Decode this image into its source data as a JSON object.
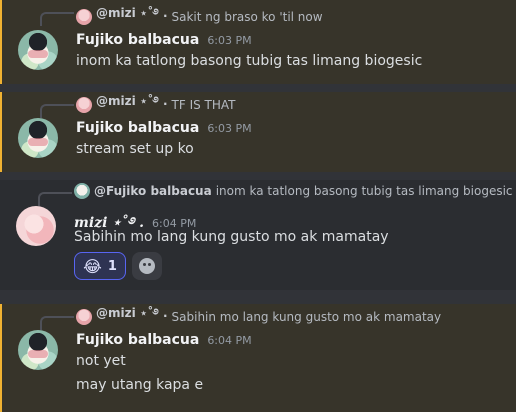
{
  "colors": {
    "background": "#313338",
    "mention_highlight": "#37342a",
    "mention_bar": "#f0b232",
    "reaction_accent": "#5865f2"
  },
  "messages": [
    {
      "reply": {
        "author": "@mizi ⋆˚࿔ .",
        "text": "Sakit ng braso ko 'til now"
      },
      "author": "Fujiko balbacua",
      "time": "6:03 PM",
      "lines": [
        "inom ka tatlong basong tubig tas limang biogesic"
      ]
    },
    {
      "reply": {
        "author": "@mizi ⋆˚࿔ .",
        "text": "TF IS THAT"
      },
      "author": "Fujiko balbacua",
      "time": "6:03 PM",
      "lines": [
        "stream set up ko"
      ]
    },
    {
      "reply": {
        "author": "@Fujiko balbacua",
        "text": "inom ka tatlong basong tubig tas limang biogesic"
      },
      "author": "mizi ⋆˚࿔ .",
      "time": "6:04 PM",
      "lines": [
        "Sabihin mo lang kung gusto mo ak mamatay"
      ],
      "reaction": {
        "emoji": "😂",
        "count": "1"
      }
    },
    {
      "reply": {
        "author": "@mizi ⋆˚࿔ .",
        "text": "Sabihin mo lang kung gusto mo ak mamatay"
      },
      "author": "Fujiko balbacua",
      "time": "6:04 PM",
      "lines": [
        "not yet",
        "may utang kapa e"
      ]
    }
  ]
}
